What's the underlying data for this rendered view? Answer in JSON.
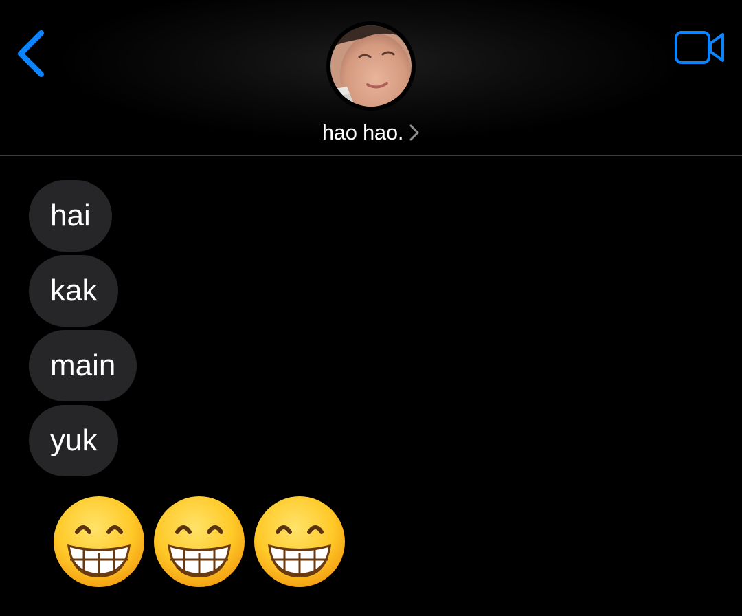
{
  "header": {
    "contact_name": "hao hao.",
    "back_icon": "chevron-left-icon",
    "video_icon": "video-camera-icon",
    "accent_color": "#0a84ff"
  },
  "messages": [
    {
      "text": "hai"
    },
    {
      "text": "kak"
    },
    {
      "text": "main"
    },
    {
      "text": "yuk"
    }
  ],
  "emoji_message": {
    "emoji": [
      "beaming-face-with-smiling-eyes",
      "beaming-face-with-smiling-eyes",
      "beaming-face-with-smiling-eyes"
    ]
  },
  "colors": {
    "background": "#000000",
    "bubble_incoming": "#262628",
    "divider": "#3a3a3c"
  }
}
